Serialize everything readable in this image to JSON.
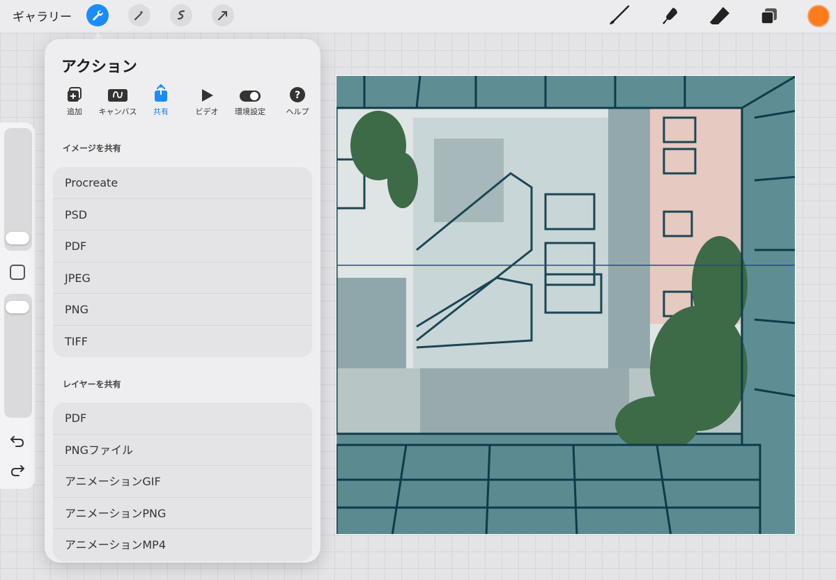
{
  "toolbar": {
    "gallery_label": "ギャラリー",
    "left_tools": [
      "wrench-icon",
      "magic-wand-icon",
      "selection-icon",
      "transform-arrow-icon"
    ],
    "right_tools": [
      "brush-icon",
      "smudge-icon",
      "eraser-icon",
      "layers-icon"
    ],
    "current_color": "#ff7a1a",
    "accent": "#1a8cff"
  },
  "panel": {
    "title": "アクション",
    "tabs": [
      {
        "label": "追加",
        "icon": "add-icon"
      },
      {
        "label": "キャンバス",
        "icon": "canvas-icon"
      },
      {
        "label": "共有",
        "icon": "share-icon"
      },
      {
        "label": "ビデオ",
        "icon": "play-icon"
      },
      {
        "label": "環境設定",
        "icon": "toggle-icon"
      },
      {
        "label": "ヘルプ",
        "icon": "help-icon"
      }
    ],
    "active_tab": "共有",
    "share_image": {
      "label": "イメージを共有",
      "items": [
        "Procreate",
        "PSD",
        "PDF",
        "JPEG",
        "PNG",
        "TIFF"
      ]
    },
    "share_layers": {
      "label": "レイヤーを共有",
      "items": [
        "PDF",
        "PNGファイル",
        "アニメーションGIF",
        "アニメーションPNG",
        "アニメーションMP4"
      ]
    }
  }
}
